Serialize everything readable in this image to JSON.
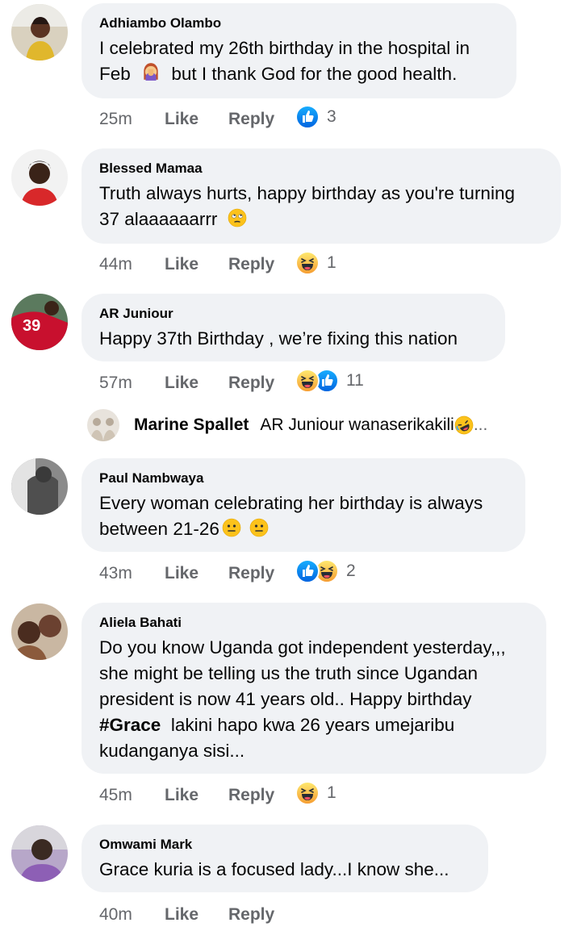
{
  "comments": [
    {
      "author": "Adhiambo Olambo",
      "text_lines": [
        "I celebrated my 26th birthday in the hospital in",
        "Feb",
        "but I thank God for the good health."
      ],
      "time": "25m",
      "like_label": "Like",
      "reply_label": "Reply",
      "reactions": [
        "like-reaction"
      ],
      "reaction_count": "3"
    },
    {
      "author": "Blessed Mamaa",
      "text_lines": [
        "Truth always hurts, happy birthday as  you're turning",
        "37 alaaaaaarrr"
      ],
      "time": "44m",
      "like_label": "Like",
      "reply_label": "Reply",
      "reactions": [
        "haha-reaction"
      ],
      "reaction_count": "1"
    },
    {
      "author": "AR Juniour",
      "text_lines": [
        "Happy 37th Birthday , we’re fixing this nation"
      ],
      "time": "57m",
      "like_label": "Like",
      "reply_label": "Reply",
      "reactions": [
        "haha-reaction",
        "like-reaction"
      ],
      "reaction_count": "11",
      "reply_preview": {
        "author": "Marine Spallet",
        "text": "AR Juniour wanaserikakili",
        "ellipsis": "..."
      }
    },
    {
      "author": "Paul Nambwaya",
      "text_lines": [
        "Every woman celebrating her birthday is always",
        "between 21-26"
      ],
      "time": "43m",
      "like_label": "Like",
      "reply_label": "Reply",
      "reactions": [
        "like-reaction",
        "haha-reaction"
      ],
      "reaction_count": "2"
    },
    {
      "author": "Aliela Bahati",
      "text_lines": [
        "Do you know Uganda got independent yesterday,,,",
        "she might be telling us the truth since Ugandan",
        "president is now 41 years old.. Happy birthday",
        "#Grace",
        "lakini hapo kwa 26 years umejaribu",
        "kudanganya sisi..."
      ],
      "time": "45m",
      "like_label": "Like",
      "reply_label": "Reply",
      "reactions": [
        "haha-reaction"
      ],
      "reaction_count": "1"
    },
    {
      "author": "Omwami Mark",
      "text_lines": [
        "Grace kuria is a focused lady...I know she..."
      ],
      "time": "40m",
      "like_label": "Like",
      "reply_label": "Reply"
    }
  ],
  "colors": {
    "bubble": "#f0f2f5",
    "secondary_text": "#65676b",
    "like_blue": "#1877f2",
    "haha_yellow": "#f7b125"
  }
}
